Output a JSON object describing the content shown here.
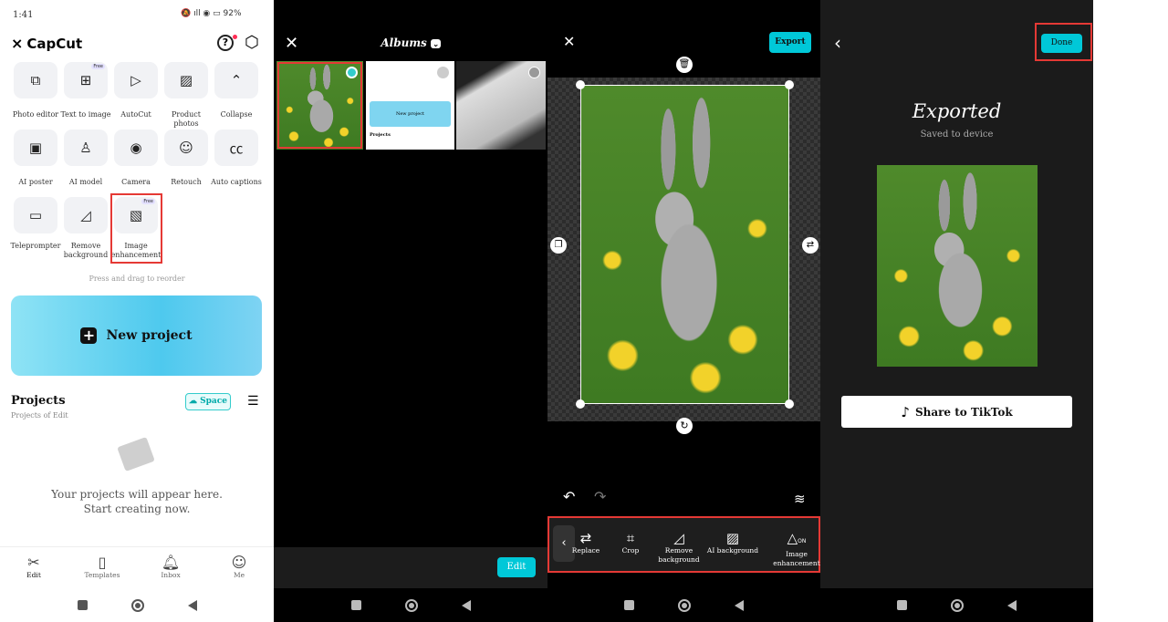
{
  "home": {
    "status": {
      "time": "1:41",
      "battery": "92%"
    },
    "app_name": "CapCut",
    "tools": [
      {
        "label": "Photo editor",
        "icon": "photo-editor-icon"
      },
      {
        "label": "Text to image",
        "icon": "text-to-image-icon",
        "badge": "Free"
      },
      {
        "label": "AutoCut",
        "icon": "autocut-icon"
      },
      {
        "label": "Product photos",
        "icon": "product-photos-icon"
      },
      {
        "label": "Collapse",
        "icon": "chevron-up-icon"
      },
      {
        "label": "AI poster",
        "icon": "ai-poster-icon"
      },
      {
        "label": "AI model",
        "icon": "ai-model-icon"
      },
      {
        "label": "Camera",
        "icon": "camera-icon"
      },
      {
        "label": "Retouch",
        "icon": "retouch-icon"
      },
      {
        "label": "Auto captions",
        "icon": "auto-captions-icon"
      },
      {
        "label": "Teleprompter",
        "icon": "teleprompter-icon"
      },
      {
        "label": "Remove background",
        "icon": "remove-background-icon"
      },
      {
        "label": "Image enhancement",
        "icon": "image-enhancement-icon",
        "badge": "Free"
      }
    ],
    "reorder_hint": "Press and drag to reorder",
    "new_project": "New project",
    "projects_title": "Projects",
    "projects_sub": "Projects of Edit",
    "space_label": "Space",
    "empty_line1": "Your projects will appear here.",
    "empty_line2": "Start creating now.",
    "nav": [
      {
        "label": "Edit"
      },
      {
        "label": "Templates"
      },
      {
        "label": "Inbox"
      },
      {
        "label": "Me"
      }
    ]
  },
  "albums": {
    "title": "Albums",
    "edit_label": "Edit",
    "thumb_new_project": "New project",
    "thumb_projects": "Projects"
  },
  "editor": {
    "export_label": "Export",
    "tools": [
      {
        "label": "Replace"
      },
      {
        "label": "Crop"
      },
      {
        "label": "Remove background"
      },
      {
        "label": "AI background"
      },
      {
        "label": "Image enhancement",
        "badge": "ON"
      }
    ]
  },
  "exported": {
    "title": "Exported",
    "subtitle": "Saved to device",
    "done_label": "Done",
    "share_label": "Share to TikTok"
  },
  "colors": {
    "accent": "#00c8d8",
    "highlight": "#e53935"
  }
}
